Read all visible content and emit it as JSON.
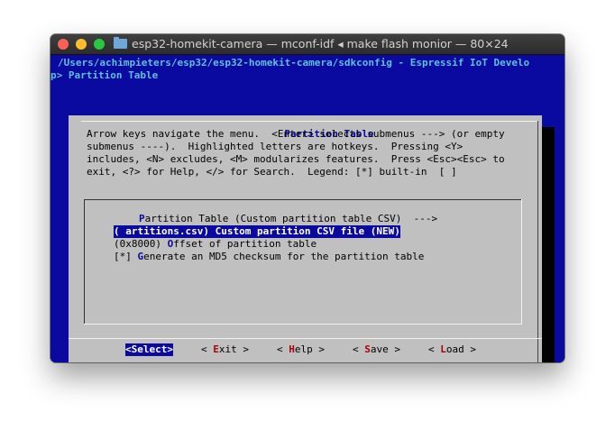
{
  "window": {
    "title": "esp32-homekit-camera — mconf-idf ◂ make flash monior — 80×24"
  },
  "terminal": {
    "path_line": "/Users/achimpieters/esp32/esp32-homekit-camera/sdkconfig - Espressif IoT Develo",
    "breadcrumb": "p> Partition Table"
  },
  "dialog": {
    "title": "Partition Table",
    "help": [
      "Arrow keys navigate the menu.  <Enter> selects submenus ---> (or empty",
      "submenus ----).  Highlighted letters are hotkeys.  Pressing <Y>",
      "includes, <N> excludes, <M> modularizes features.  Press <Esc><Esc> to",
      "exit, <?> for Help, </> for Search.  Legend: [*] built-in  [ ]"
    ],
    "menu_items": [
      {
        "pre": "",
        "hotkey": "P",
        "rest": "artition Table (Custom partition table CSV)  --->"
      },
      {
        "pre": "(",
        "hotkey": " ",
        "rest": "artitions.csv) Custom partition CSV file (NEW)",
        "selected_hotkey": "C"
      },
      {
        "pre": "(0x8000) ",
        "hotkey": "O",
        "rest": "ffset of partition table"
      },
      {
        "pre": "[*] ",
        "hotkey": "G",
        "rest": "enerate an MD5 checksum for the partition table"
      }
    ],
    "buttons": [
      {
        "open": "<",
        "hotkey": "S",
        "rest": "elect",
        "close": ">"
      },
      {
        "open": "< ",
        "hotkey": "E",
        "rest": "xit",
        "close": " >"
      },
      {
        "open": "< ",
        "hotkey": "H",
        "rest": "elp",
        "close": " >"
      },
      {
        "open": "< ",
        "hotkey": "S",
        "rest": "ave",
        "close": " >"
      },
      {
        "open": "< ",
        "hotkey": "L",
        "rest": "oad",
        "close": " >"
      }
    ]
  },
  "colors": {
    "terminal_bg": "#0a0aa0",
    "dialog_bg": "#c0c0c0",
    "path_text": "#5fc0d8",
    "hotkey_blue": "#0a0aa0",
    "hotkey_red": "#b00000"
  }
}
